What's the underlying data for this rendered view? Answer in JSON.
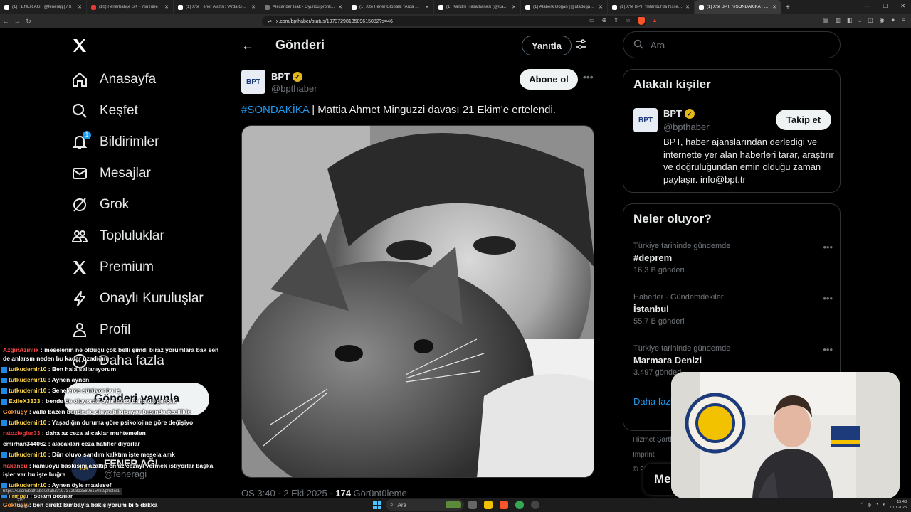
{
  "browser": {
    "tabs": [
      {
        "title": "(1) FENER AĞI (@feneragi) / X",
        "icon": "x"
      },
      {
        "title": "(10) Fenerbahçe SK - YouTube",
        "icon": "yt"
      },
      {
        "title": "(1) X'te Fener Ajansı: \"Arda Güler'e...",
        "icon": "x"
      },
      {
        "title": "Alexander Isak - Oyuncu profili 25/26",
        "icon": "other"
      },
      {
        "title": "(1) X'te Fener Globalli: \"Arda Güler, Tü...",
        "icon": "x"
      },
      {
        "title": "(1) Kandilli Rasathanesi (@Kandilli_in...",
        "icon": "x"
      },
      {
        "title": "(1) Ataberk Doğan (@atadogann) / X",
        "icon": "x"
      },
      {
        "title": "(1) X'te BPT: \"İstanbul'da hissedilen...",
        "icon": "x"
      },
      {
        "title": "(1) X'te BPT: \"#SONDAKİKA | Ma...",
        "icon": "x",
        "active": true
      }
    ],
    "url": "x.com/bpthaber/status/1973729813589615082?s=46",
    "status_url": "https://x.com/bpthaber/status/1973729813589615082/photo/1"
  },
  "left_nav": {
    "items": [
      {
        "label": "Anasayfa",
        "icon": "home-icon"
      },
      {
        "label": "Keşfet",
        "icon": "search-icon"
      },
      {
        "label": "Bildirimler",
        "icon": "bell-icon",
        "badge": "1"
      },
      {
        "label": "Mesajlar",
        "icon": "mail-icon"
      },
      {
        "label": "Grok",
        "icon": "grok-icon"
      },
      {
        "label": "Topluluklar",
        "icon": "communities-icon"
      },
      {
        "label": "Premium",
        "icon": "x-premium-icon"
      },
      {
        "label": "Onaylı Kuruluşlar",
        "icon": "lightning-icon"
      },
      {
        "label": "Profil",
        "icon": "person-icon"
      },
      {
        "label": "Daha fazla",
        "icon": "more-circle-icon"
      }
    ],
    "post_button": "Gönderi yayınla",
    "account": {
      "name": "FENER AĞI",
      "handle": "@feneragi"
    }
  },
  "main": {
    "title": "Gönderi",
    "reply_button": "Yanıtla",
    "author": {
      "name": "BPT",
      "handle": "@bpthaber",
      "avatar_text": "BPT"
    },
    "subscribe_button": "Abone ol",
    "hashtag": "#SONDAKİKA",
    "text": " | Mattia Ahmet Minguzzi davası 21 Ekim'e ertelendi.",
    "meta_time": "ÖS 3:40 · 2 Eki 2025 · ",
    "meta_views": "174",
    "meta_views_label": " Görüntüleme"
  },
  "right": {
    "search_placeholder": "Ara",
    "related": {
      "title": "Alakalı kişiler",
      "name": "BPT",
      "handle": "@bpthaber",
      "follow_button": "Takip et",
      "bio": "BPT, haber ajanslarından derlediği ve internette yer alan haberleri tarar, araştırır ve doğruluğundan emin olduğu zaman paylaşır. info@bpt.tr"
    },
    "trends": {
      "title": "Neler oluyor?",
      "items": [
        {
          "context": "Türkiye tarihinde gündemde",
          "name": "#deprem",
          "count": "16,3 B gönderi"
        },
        {
          "context": "Haberler · Gündemdekiler",
          "name": "İstanbul",
          "count": "55,7 B gönderi"
        },
        {
          "context": "Türkiye tarihinde gündemde",
          "name": "Marmara Denizi",
          "count": "3.497 gönderi"
        }
      ],
      "show_more": "Daha fazla göster"
    },
    "footer": [
      "Hizmet Şartları",
      "Imprint",
      "© 2025 X Corp."
    ],
    "messages_label": "Me"
  },
  "chat": [
    {
      "user": "AzginAzinlik",
      "color": "#ff4d4d",
      "text": "meselenin ne olduğu çok belli şimdi biraz yorumlara bak sen de anlarsın neden bu kadar uzadığını",
      "wrap": true
    },
    {
      "user": "tutkudemir10",
      "color": "#ffd54a",
      "text": "Ben hala sallanıyorum",
      "icon": true
    },
    {
      "user": "tutkudemir10",
      "color": "#ffd54a",
      "text": "Aynen aynen",
      "icon": true
    },
    {
      "user": "tutkudemir10",
      "color": "#ffd54a",
      "text": "Senelerce sürüyor bu iş",
      "icon": true
    },
    {
      "user": "ExileX3333",
      "color": "#ffd54a",
      "text": "bende de oluyordu oyunlarda daha da gerçek",
      "icon": true
    },
    {
      "user": "Goktugy",
      "color": "#ff9f40",
      "text": "valla bazen bende de oluyo bilgisayar başında özellikle"
    },
    {
      "user": "tutkudemir10",
      "color": "#ffd54a",
      "text": "Yaşadığın duruma göre psikolojine göre değişiyo",
      "icon": true
    },
    {
      "user": "ratoziegler33",
      "color": "#e53935",
      "text": "daha az ceza alıcaklar muhtemelen"
    },
    {
      "user": "emirhan344062",
      "color": "#ffffff",
      "text": "alacakları ceza hafifler diyorlar"
    },
    {
      "user": "tutkudemir10",
      "color": "#ffd54a",
      "text": "Dün oluyo sandım kalktım işte mesela amk",
      "icon": true
    },
    {
      "user": "hakancu",
      "color": "#ff4d4d",
      "text": "kamuoyu baskısını azaltıp en az cezayı vermek istiyorlar başka işler var bu işte buğra",
      "wrap": true
    },
    {
      "user": "tutkudemir10",
      "color": "#ffd54a",
      "text": "Aynen öyle maalesef",
      "icon": true
    },
    {
      "user": "lirmbal",
      "color": "#ffd54a",
      "text": "selam dostlar",
      "icon": true
    }
  ],
  "taskbar": {
    "chat_user": "Goktugy",
    "chat_text": "ben direkt lambayla bakışıyorum bi 5 dakka",
    "weather": "27°C",
    "weather_desc": "Güneşli",
    "search": "Ara",
    "time": "15:43",
    "date": "2.10.2025"
  },
  "colors": {
    "accent": "#1d9bf0",
    "verified": "#e2b719",
    "border": "#2f3336"
  }
}
